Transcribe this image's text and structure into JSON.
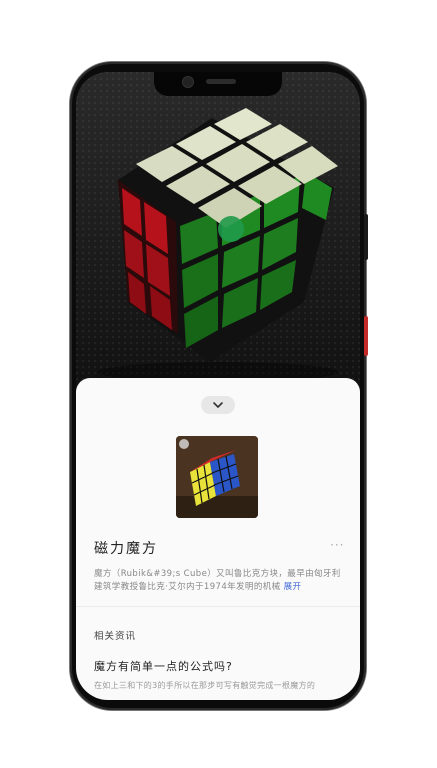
{
  "article": {
    "title": "磁力魔方",
    "more_label": "···",
    "description": "魔方（Rubik&#39;s Cube）又叫鲁比克方块，最早由匈牙利建筑学教授鲁比克·艾尔内于1974年发明的机械",
    "expand_label": "展开"
  },
  "related": {
    "section_label": "相关资讯",
    "item_title": "魔方有简单一点的公式吗?",
    "item_snippet": "在如上三和下的3的手所以在那步可写有触觉完成一根魔方的"
  },
  "colors": {
    "sheet_bg": "#fafafa",
    "accent_link": "#3f6ad8",
    "focus_dot": "#1f9a4a",
    "red_button": "#c22a2a"
  }
}
